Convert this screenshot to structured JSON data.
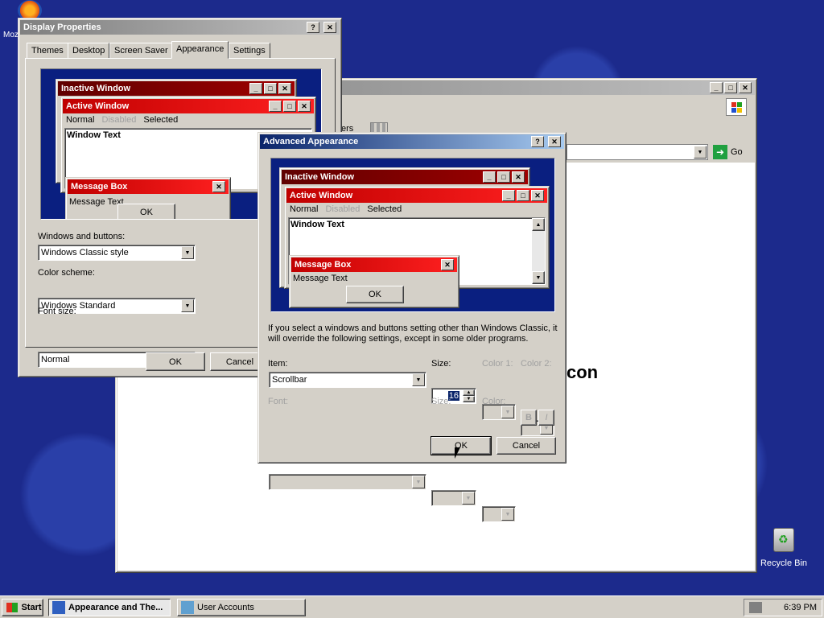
{
  "desktop": {
    "firefox_label": "Moz",
    "recycle_bin_label": "Recycle Bin"
  },
  "bg_window": {
    "address_text": "",
    "go_label": "Go",
    "toolbar_partial": "ers",
    "content_partial": "con"
  },
  "display_props": {
    "title": "Display Properties",
    "tabs": [
      "Themes",
      "Desktop",
      "Screen Saver",
      "Appearance",
      "Settings"
    ],
    "preview": {
      "inactive_title": "Inactive Window",
      "active_title": "Active Window",
      "menu_normal": "Normal",
      "menu_disabled": "Disabled",
      "menu_selected": "Selected",
      "window_text": "Window Text",
      "msgbox_title": "Message Box",
      "msgbox_text": "Message Text",
      "msgbox_ok": "OK"
    },
    "windows_buttons_label": "Windows and buttons:",
    "windows_buttons_value": "Windows Classic style",
    "color_scheme_label": "Color scheme:",
    "color_scheme_value": "Windows Standard",
    "font_size_label": "Font size:",
    "font_size_value": "Normal",
    "ok_label": "OK",
    "cancel_label": "Cancel"
  },
  "advanced": {
    "title": "Advanced Appearance",
    "preview": {
      "inactive_title": "Inactive Window",
      "active_title": "Active Window",
      "menu_normal": "Normal",
      "menu_disabled": "Disabled",
      "menu_selected": "Selected",
      "window_text": "Window Text",
      "msgbox_title": "Message Box",
      "msgbox_text": "Message Text",
      "msgbox_ok": "OK"
    },
    "info_text": "If you select a windows and buttons setting other than Windows Classic, it will override the following settings, except in some older programs.",
    "item_label": "Item:",
    "item_value": "Scrollbar",
    "size_label": "Size:",
    "size_value": "16",
    "color1_label": "Color 1:",
    "color2_label": "Color 2:",
    "font_label": "Font:",
    "font_size_label": "Size:",
    "font_color_label": "Color:",
    "bold_label": "B",
    "italic_label": "I",
    "ok_label": "OK",
    "cancel_label": "Cancel"
  },
  "taskbar": {
    "start_label": "Start",
    "tasks": [
      "Appearance and The...",
      "User Accounts"
    ],
    "clock": "6:39 PM"
  },
  "colors": {
    "desktop": "#1c2a8c",
    "title_active": "#0a246a",
    "preview_bg": "#0a1f80",
    "preview_active": "#ff2020"
  }
}
